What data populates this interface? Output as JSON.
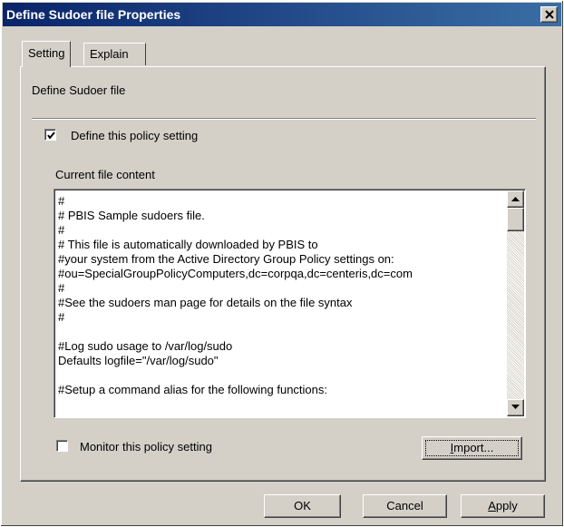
{
  "window": {
    "title": "Define Sudoer file Properties"
  },
  "tabs": [
    {
      "label": "Setting",
      "active": true
    },
    {
      "label": "Explain",
      "active": false
    }
  ],
  "panel": {
    "title": "Define Sudoer file",
    "define_checkbox": {
      "label": "Define this policy setting",
      "checked": true
    },
    "content_label": "Current file content",
    "file_lines": [
      "#",
      "# PBIS Sample sudoers file.",
      "#",
      "# This file is automatically downloaded by PBIS to",
      "#your system from the Active Directory Group Policy settings on:",
      "#ou=SpecialGroupPolicyComputers,dc=corpqa,dc=centeris,dc=com",
      "#",
      "#See the sudoers man page for details on the file syntax",
      "#",
      "",
      "#Log sudo usage to /var/log/sudo",
      "Defaults logfile=\"/var/log/sudo\"",
      "",
      "#Setup a command alias for the following functions:"
    ],
    "monitor_checkbox": {
      "label": "Monitor this policy setting",
      "checked": false
    },
    "import_button": {
      "label_underlined": "I",
      "label_rest": "mport..."
    }
  },
  "buttons": {
    "ok": "OK",
    "cancel": "Cancel",
    "apply_underlined": "A",
    "apply_rest": "pply"
  },
  "icons": {
    "close": "close-icon",
    "checkmark": "checkmark-icon",
    "scroll_up": "arrow-up-icon",
    "scroll_down": "arrow-down-icon"
  },
  "colors": {
    "title_start": "#0a246a",
    "title_end": "#3a6ea5",
    "face": "#d4d0c8"
  }
}
